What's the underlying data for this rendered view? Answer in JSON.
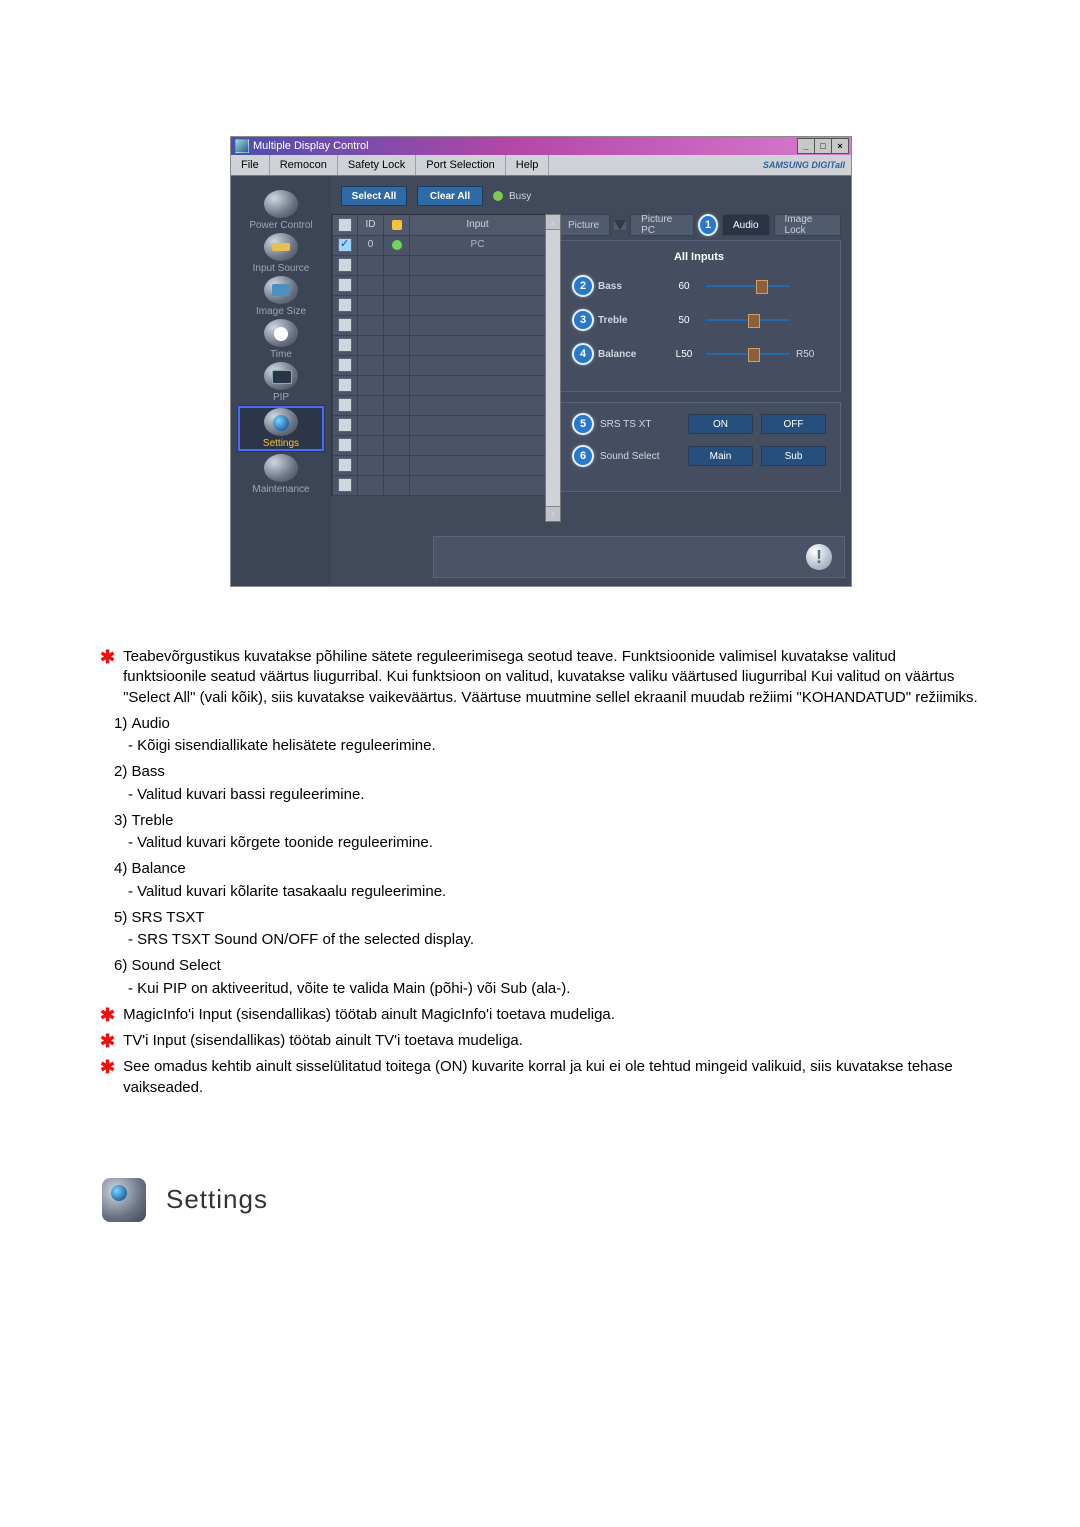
{
  "window": {
    "title": "Multiple Display Control",
    "brand": "SAMSUNG DIGITall"
  },
  "menubar": [
    "File",
    "Remocon",
    "Safety Lock",
    "Port Selection",
    "Help"
  ],
  "sidebar": [
    {
      "label": "Power Control",
      "icon": "power"
    },
    {
      "label": "Input Source",
      "icon": "input"
    },
    {
      "label": "Image Size",
      "icon": "size"
    },
    {
      "label": "Time",
      "icon": "time"
    },
    {
      "label": "PIP",
      "icon": "pip"
    },
    {
      "label": "Settings",
      "icon": "settings",
      "active": true
    },
    {
      "label": "Maintenance",
      "icon": "maint"
    }
  ],
  "toolbar": {
    "select_all": "Select All",
    "clear_all": "Clear All",
    "busy": "Busy"
  },
  "table": {
    "headers": {
      "chk": "☑",
      "id": "ID",
      "status": "",
      "input": "Input"
    },
    "rows": [
      {
        "checked": true,
        "id": "0",
        "status": "g",
        "input": "PC"
      },
      {
        "checked": false
      },
      {
        "checked": false
      },
      {
        "checked": false
      },
      {
        "checked": false
      },
      {
        "checked": false
      },
      {
        "checked": false
      },
      {
        "checked": false
      },
      {
        "checked": false
      },
      {
        "checked": false
      },
      {
        "checked": false
      },
      {
        "checked": false
      },
      {
        "checked": false
      }
    ]
  },
  "tabs": {
    "picture": "Picture",
    "picture_pc": "Picture PC",
    "audio": "Audio",
    "image_lock": "Image Lock",
    "active_marker": "1"
  },
  "audio_panel": {
    "title": "All Inputs",
    "bass": {
      "marker": "2",
      "label": "Bass",
      "value": "60",
      "pos": 60
    },
    "treble": {
      "marker": "3",
      "label": "Treble",
      "value": "50",
      "pos": 50
    },
    "balance": {
      "marker": "4",
      "label": "Balance",
      "left": "L50",
      "right": "R50",
      "pos": 50
    },
    "srs": {
      "marker": "5",
      "label": "SRS TS XT",
      "on": "ON",
      "off": "OFF"
    },
    "sound_select": {
      "marker": "6",
      "label": "Sound Select",
      "main": "Main",
      "sub": "Sub"
    }
  },
  "doc": {
    "p_main": "Teabevõrgustikus kuvatakse põhiline sätete reguleerimisega seotud teave. Funktsioonide valimisel kuvatakse valitud funktsioonile seatud väärtus liugurribal. Kui funktsioon on valitud, kuvatakse valiku väärtused liugurribal Kui valitud on väärtus \"Select All\" (vali kõik), siis kuvatakse vaikeväärtus. Väärtuse muutmine sellel ekraanil muudab režiimi \"KOHANDATUD\" režiimiks.",
    "items": [
      {
        "n": "1)",
        "t": "Audio",
        "d": "- Kõigi sisendiallikate helisätete reguleerimine."
      },
      {
        "n": "2)",
        "t": "Bass",
        "d": "- Valitud kuvari bassi reguleerimine."
      },
      {
        "n": "3)",
        "t": "Treble",
        "d": "- Valitud kuvari kõrgete toonide reguleerimine."
      },
      {
        "n": "4)",
        "t": "Balance",
        "d": "- Valitud kuvari kõlarite tasakaalu reguleerimine."
      },
      {
        "n": "5)",
        "t": "SRS TSXT",
        "d": "- SRS TSXT Sound ON/OFF of the selected display."
      },
      {
        "n": "6)",
        "t": "Sound Select",
        "d": "- Kui PIP on aktiveeritud, võite te valida Main (põhi-) või Sub (ala-)."
      }
    ],
    "s1": "MagicInfo'i Input (sisendallikas) töötab ainult MagicInfo'i toetava mudeliga.",
    "s2": "TV'i Input (sisendallikas) töötab ainult TV'i toetava mudeliga.",
    "s3": "See omadus kehtib ainult sisselülitatud toitega (ON) kuvarite korral ja kui ei ole tehtud mingeid valikuid, siis kuvatakse tehase vaikseaded.",
    "section_title": "Settings"
  }
}
